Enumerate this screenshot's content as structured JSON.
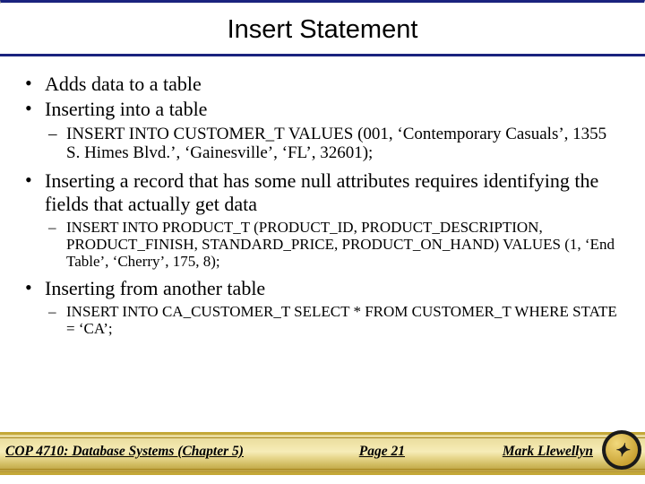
{
  "title": "Insert Statement",
  "bullets": {
    "b1": "Adds data to a table",
    "b2": "Inserting into a table",
    "b2s1": "INSERT INTO CUSTOMER_T VALUES (001, ‘Contemporary Casuals’, 1355 S. Himes Blvd.’, ‘Gainesville’, ‘FL’, 32601);",
    "b3": "Inserting a record that has some null attributes requires identifying the fields that actually get data",
    "b3s1": "INSERT INTO PRODUCT_T (PRODUCT_ID, PRODUCT_DESCRIPTION, PRODUCT_FINISH, STANDARD_PRICE, PRODUCT_ON_HAND) VALUES (1, ‘End Table’, ‘Cherry’, 175, 8);",
    "b4": "Inserting from another table",
    "b4s1": "INSERT INTO CA_CUSTOMER_T SELECT * FROM CUSTOMER_T WHERE STATE = ‘CA’;"
  },
  "footer": {
    "left": "COP 4710: Database Systems  (Chapter 5)",
    "center": "Page 21",
    "right": "Mark Llewellyn"
  }
}
